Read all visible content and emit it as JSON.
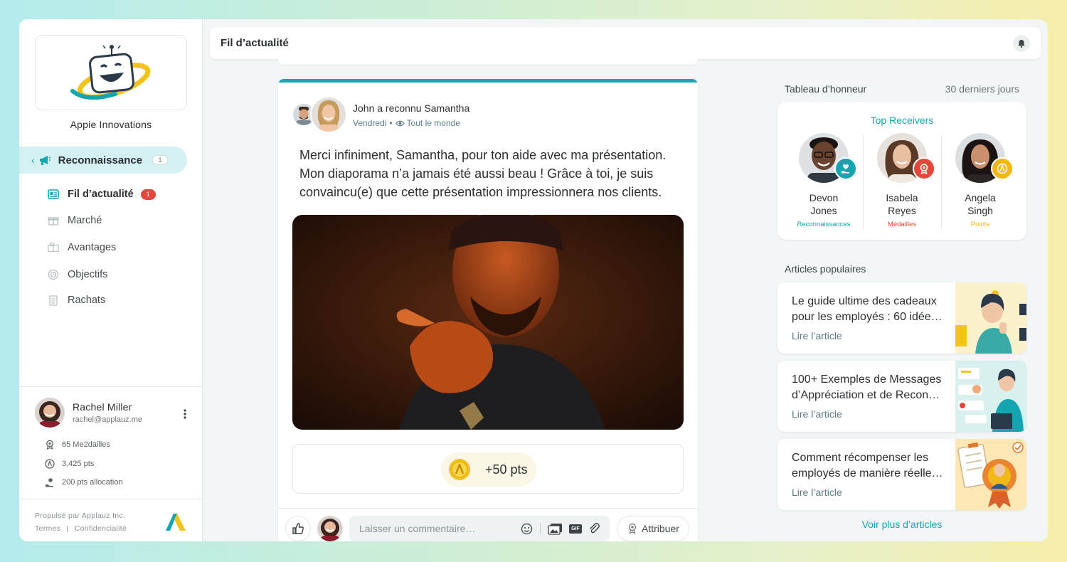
{
  "app": {
    "company_name": "Appie Innovations"
  },
  "sidebar": {
    "main_nav": {
      "label": "Reconnaissance",
      "count": "1"
    },
    "items": [
      {
        "label": "Fil d’actualité",
        "badge": "1",
        "icon": "feed-icon",
        "active": true
      },
      {
        "label": "Marché",
        "icon": "gift-icon"
      },
      {
        "label": "Avantages",
        "icon": "perks-icon"
      },
      {
        "label": "Objectifs",
        "icon": "target-icon"
      },
      {
        "label": "Rachats",
        "icon": "clipboard-icon"
      }
    ],
    "user": {
      "name": "Rachel Miller",
      "email": "rachel@applauz.me",
      "stats": [
        {
          "label": "65 Me2dailles",
          "icon": "medal-icon"
        },
        {
          "label": "3,425 pts",
          "icon": "points-icon"
        },
        {
          "label": "200 pts allocation",
          "icon": "allocation-icon"
        }
      ]
    },
    "footer": {
      "powered": "Propulsé par Applauz Inc.",
      "terms": "Termes",
      "separator": "|",
      "privacy": "Confidencialité"
    }
  },
  "header": {
    "title": "Fil d’actualité"
  },
  "post": {
    "headline": "John a reconnu Samantha",
    "date": "Vendredi",
    "dot": "•",
    "audience": "Tout le monde",
    "message": "Merci infiniment, Samantha, pour ton aide avec ma présentation. Mon diaporama n’a jamais été aussi beau ! Grâce à toi, je suis convaincu(e) que cette présentation impressionnera nos clients.",
    "points": "+50 pts",
    "comment_placeholder": "Laisser un commentaire…",
    "gif_label": "GIF",
    "attribute_label": "Attribuer"
  },
  "honor_roll": {
    "title": "Tableau d’honneur",
    "period": "30 derniers jours",
    "header": "Top Receivers",
    "people": [
      {
        "name": "Devon\nJones",
        "category": "Reconnaissances",
        "color": "#14a5b0"
      },
      {
        "name": "Isabela\nReyes",
        "category": "Médailles",
        "color": "#e6463a"
      },
      {
        "name": "Angela\nSingh",
        "category": "Points",
        "color": "#f2b816"
      }
    ]
  },
  "articles": {
    "title": "Articles populaires",
    "items": [
      {
        "title": "Le guide ultime des cadeaux pour les employés : 60 idée…",
        "link": "Lire l’article"
      },
      {
        "title": "100+ Exemples de Messages d’Appréciation et de Recon…",
        "link": "Lire l’article"
      },
      {
        "title": "Comment récompenser les employés de manière réelle…",
        "link": "Lire l’article"
      }
    ],
    "more": "Voir plus d’articles"
  },
  "colors": {
    "accent": "#14a5b0",
    "badge_red": "#e6463a",
    "gold": "#f2b816"
  }
}
